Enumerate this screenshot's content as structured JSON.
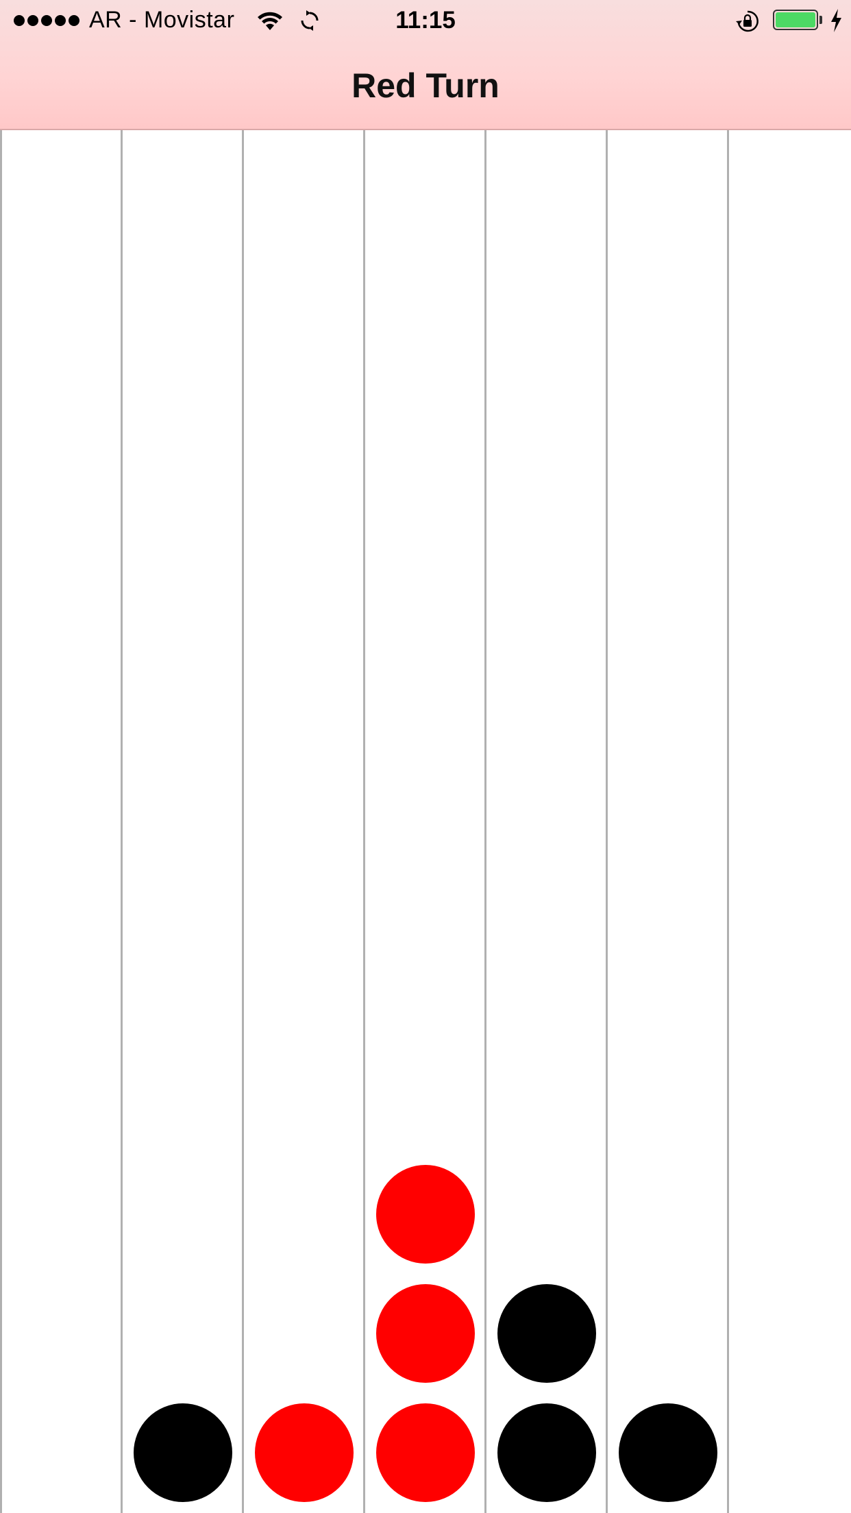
{
  "status_bar": {
    "carrier": "AR - Movistar",
    "time": "11:15",
    "signal_bars": 5,
    "battery_color": "#4cd964",
    "icons": [
      "wifi-icon",
      "sync-icon",
      "rotation-lock-icon",
      "battery-icon",
      "charging-icon"
    ]
  },
  "header": {
    "title": "Red Turn",
    "background_color": "#ffd4d4"
  },
  "board": {
    "columns": 7,
    "discs": [
      {
        "column": 1,
        "row": 0,
        "player": "black"
      },
      {
        "column": 2,
        "row": 0,
        "player": "red"
      },
      {
        "column": 3,
        "row": 0,
        "player": "red"
      },
      {
        "column": 3,
        "row": 1,
        "player": "red"
      },
      {
        "column": 3,
        "row": 2,
        "player": "red"
      },
      {
        "column": 4,
        "row": 0,
        "player": "black"
      },
      {
        "column": 4,
        "row": 1,
        "player": "black"
      },
      {
        "column": 5,
        "row": 0,
        "player": "black"
      }
    ],
    "colors": {
      "red": "#ff0000",
      "black": "#000000",
      "divider": "#b0b0b0"
    }
  }
}
